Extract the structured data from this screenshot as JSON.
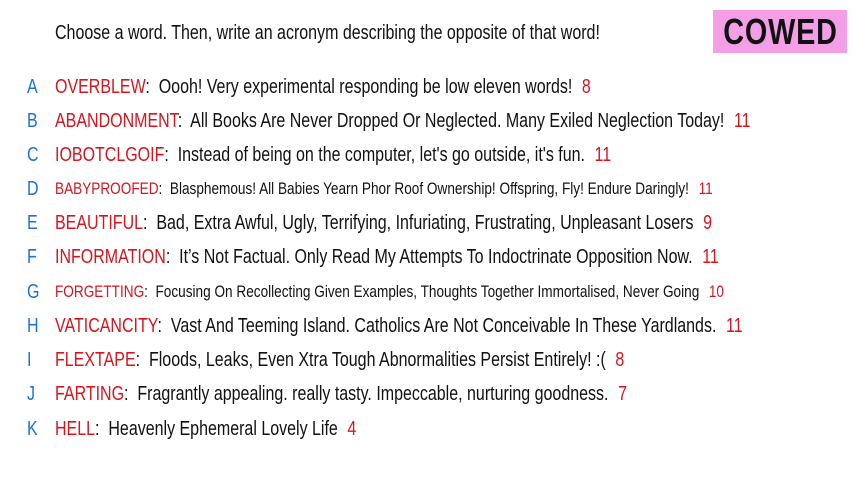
{
  "prompt": "Choose a word. Then, write an acronym describing the opposite of that word!",
  "badge": {
    "label": "COWED",
    "color": "#f59ee8"
  },
  "colors": {
    "letter": "#1a72d6",
    "word": "#d8141e",
    "count": "#d8141e",
    "text": "#111111"
  },
  "answers": [
    {
      "letter": "A",
      "word": "OVERBLEW",
      "text": "Oooh! Very experimental responding be low eleven words!",
      "count": "8"
    },
    {
      "letter": "B",
      "word": "ABANDONMENT",
      "text": "All Books Are Never Dropped Or Neglected. Many Exiled Neglection Today!",
      "count": "11"
    },
    {
      "letter": "C",
      "word": "IOBOTCLGOIF",
      "text": "Instead of being on the computer, let's go outside, it's fun.",
      "count": "11"
    },
    {
      "letter": "D",
      "word": "BABYPROOFED",
      "text": "Blasphemous! All Babies Yearn Phor Roof Ownership! Offspring, Fly! Endure Daringly!",
      "count": "11"
    },
    {
      "letter": "E",
      "word": "BEAUTIFUL",
      "text": "Bad, Extra Awful, Ugly, Terrifying, Infuriating, Frustrating, Unpleasant Losers",
      "count": "9"
    },
    {
      "letter": "F",
      "word": "INFORMATION",
      "text": "It’s Not Factual. Only Read My Attempts To Indoctrinate Opposition Now.",
      "count": "11"
    },
    {
      "letter": "G",
      "word": "FORGETTING",
      "text": "Focusing On Recollecting Given Examples, Thoughts Together Immortalised, Never Going",
      "count": "10"
    },
    {
      "letter": "H",
      "word": "VATICANCITY",
      "text": "Vast And Teeming Island. Catholics Are Not Conceivable In These Yardlands.",
      "count": "11"
    },
    {
      "letter": "I",
      "word": "FLEXTAPE",
      "text": "Floods, Leaks, Even Xtra Tough Abnormalities Persist Entirely! :(",
      "count": "8"
    },
    {
      "letter": "J",
      "word": "FARTING",
      "text": "Fragrantly appealing. really tasty. Impeccable, nurturing goodness.",
      "count": "7"
    },
    {
      "letter": "K",
      "word": "HELL",
      "text": "Heavenly Ephemeral Lovely Life",
      "count": "4"
    }
  ]
}
